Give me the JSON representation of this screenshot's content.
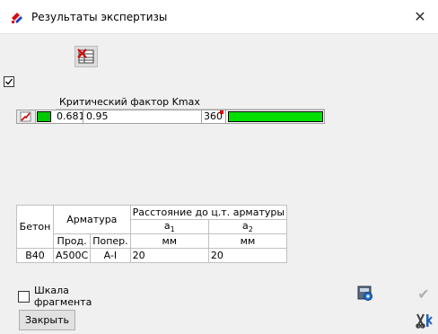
{
  "window": {
    "title": "Результаты экспертизы",
    "close_glyph": "✕"
  },
  "critical": {
    "header": "Критический фактор Kmax",
    "row": {
      "value1": "0.681",
      "value2": "0.95",
      "angle": "360",
      "color": "#00c800",
      "bar_color": "#00e000"
    }
  },
  "table": {
    "headers": {
      "concrete": "Бетон",
      "rebar": "Арматура",
      "distance": "Расстояние до ц.т. арматуры",
      "a1": "a",
      "a1_sub": "1",
      "a2": "a",
      "a2_sub": "2",
      "long": "Прод.",
      "trans": "Попер.",
      "unit1": "мм",
      "unit2": "мм"
    },
    "row": {
      "concrete": "B40",
      "long": "A500C",
      "trans": "A-I",
      "a1": "20",
      "a2": "20"
    }
  },
  "footer": {
    "scale_label_1": "Шкала",
    "scale_label_2": "фрагмента",
    "close_button": "Закрыть",
    "ok_glyph": "✔"
  }
}
